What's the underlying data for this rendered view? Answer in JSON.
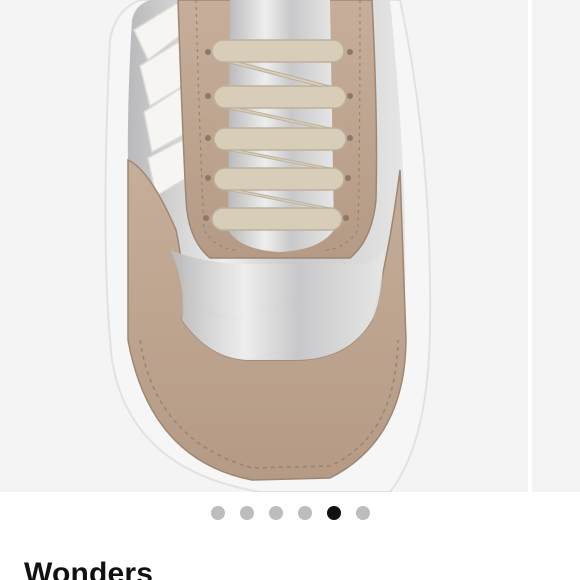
{
  "product": {
    "brand": "Wonders",
    "image_alt_icon": "sneaker-photo"
  },
  "carousel": {
    "slide_count": 6,
    "active_index": 4,
    "colors": {
      "dot": "#bdbdbd",
      "dot_active": "#111111"
    }
  },
  "colors": {
    "suede": "#c2a995",
    "suede_dark": "#a8907c",
    "silver": "#d9d9d9",
    "lace": "#d8cdb8",
    "sole": "#f2f2f2",
    "logo": "#f7f5f2"
  }
}
